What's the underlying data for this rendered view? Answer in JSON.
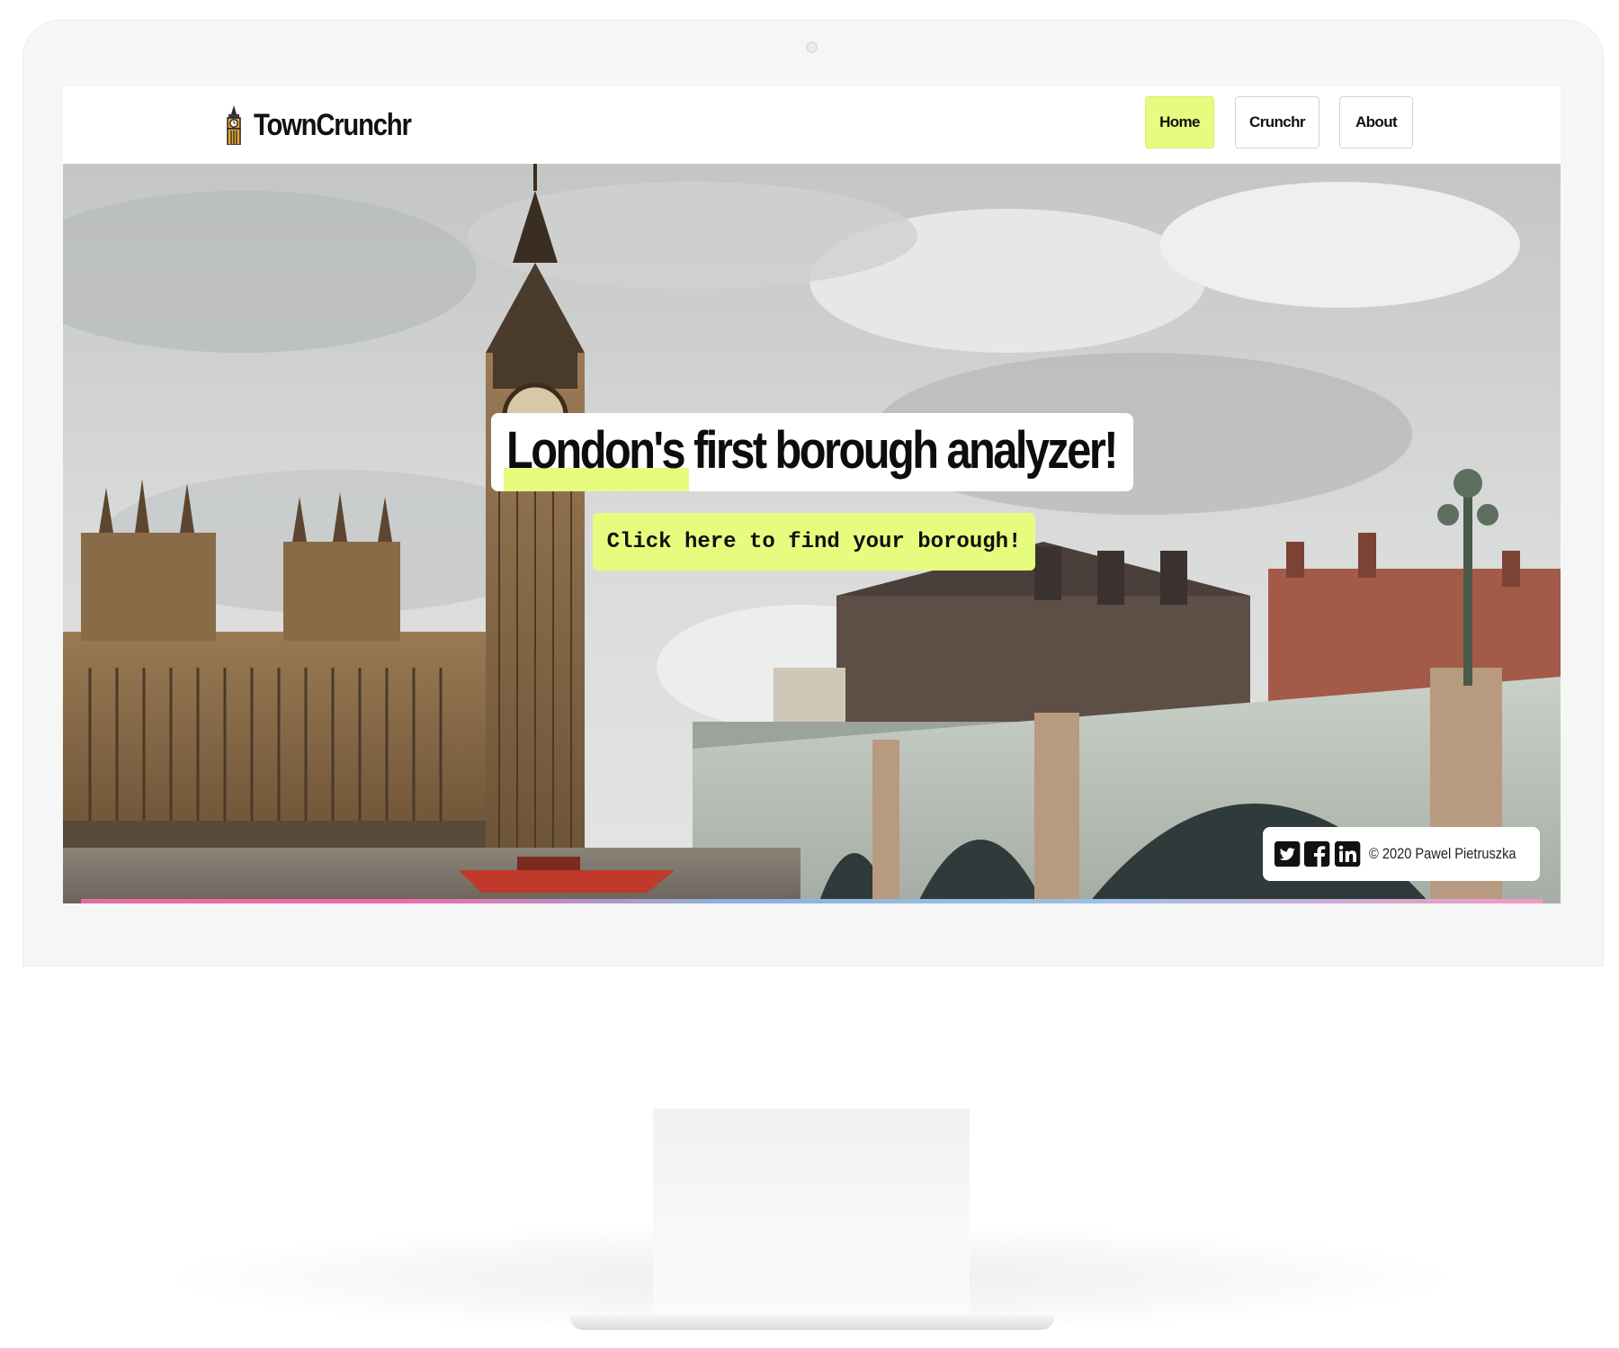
{
  "brand": {
    "name": "TownCrunchr",
    "icon": "big-ben-clock-icon"
  },
  "nav": {
    "items": [
      {
        "label": "Home",
        "active": true
      },
      {
        "label": "Crunchr",
        "active": false
      },
      {
        "label": "About",
        "active": false
      }
    ]
  },
  "hero": {
    "headline": "London's first borough analyzer!",
    "cta_label": "Click here to find your borough!",
    "background": "london-westminster-photo"
  },
  "footer": {
    "social": [
      "twitter-icon",
      "facebook-icon",
      "linkedin-icon"
    ],
    "copyright": "© 2020 Pawel Pietruszka"
  },
  "colors": {
    "accent": "#e6fc7e",
    "text": "#111111",
    "underline_gradient": [
      "#e66aa3",
      "#8ab3e0",
      "#f09ac4"
    ]
  }
}
